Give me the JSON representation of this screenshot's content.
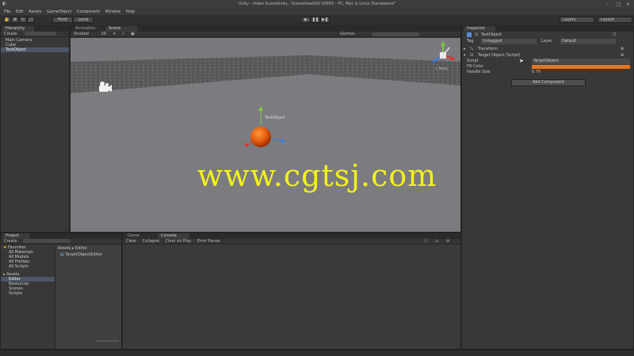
{
  "window": {
    "title": "Unity - Video SceneUnity - SceneViewGUI VIDEO - PC, Mac & Linux Standalone*"
  },
  "menu": [
    "File",
    "Edit",
    "Assets",
    "GameObject",
    "Component",
    "Window",
    "Help"
  ],
  "toolbar": {
    "pivot": "Pivot",
    "local": "Local",
    "layers": "Layers",
    "layout": "Layout",
    "play": "▶",
    "pause": "❚❚",
    "step": "▶❚"
  },
  "hierarchy": {
    "tab": "Hierarchy",
    "create": "Create",
    "items": [
      "Main Camera",
      "Cube",
      "TestObject"
    ],
    "selected_index": 2
  },
  "scene": {
    "tab_animation": "Animation",
    "tab_scene": "Scene",
    "shaded": "Shaded",
    "mode_2d": "2D",
    "gizmos": "Gizmos",
    "search": "All"
  },
  "inspector": {
    "tab": "Inspector",
    "object_name": "TestObject",
    "tag_label": "Tag",
    "tag_value": "Untagged",
    "layer_label": "Layer",
    "layer_value": "Default",
    "transform": "Transform",
    "component": "Target Object (Script)",
    "script_label": "Script",
    "script_value": "TargetObject",
    "color_label": "Fill Color",
    "color_value": "#e8731a",
    "handle_label": "Handle Size",
    "handle_value": "0.75",
    "add_component": "Add Component"
  },
  "project": {
    "tab": "Project",
    "create": "Create",
    "favorites": "Favorites",
    "favorites_items": [
      "All Materials",
      "All Models",
      "All Prefabs",
      "All Scripts"
    ],
    "assets": "Assets",
    "assets_items": [
      "Editor",
      "Resources",
      "Scenes",
      "Scripts"
    ],
    "breadcrumb": "Assets ▸ Editor",
    "file": "TargetObjectEditor"
  },
  "console": {
    "tab_game": "Game",
    "tab_console": "Console",
    "buttons": [
      "Clear",
      "Collapse",
      "Clear on Play",
      "Error Pause"
    ]
  },
  "watermark": "www.cgtsj.com",
  "colors": {
    "sphere": "#e35a10",
    "accent_sel": "#4c5666",
    "watermark": "#f2f21a"
  }
}
